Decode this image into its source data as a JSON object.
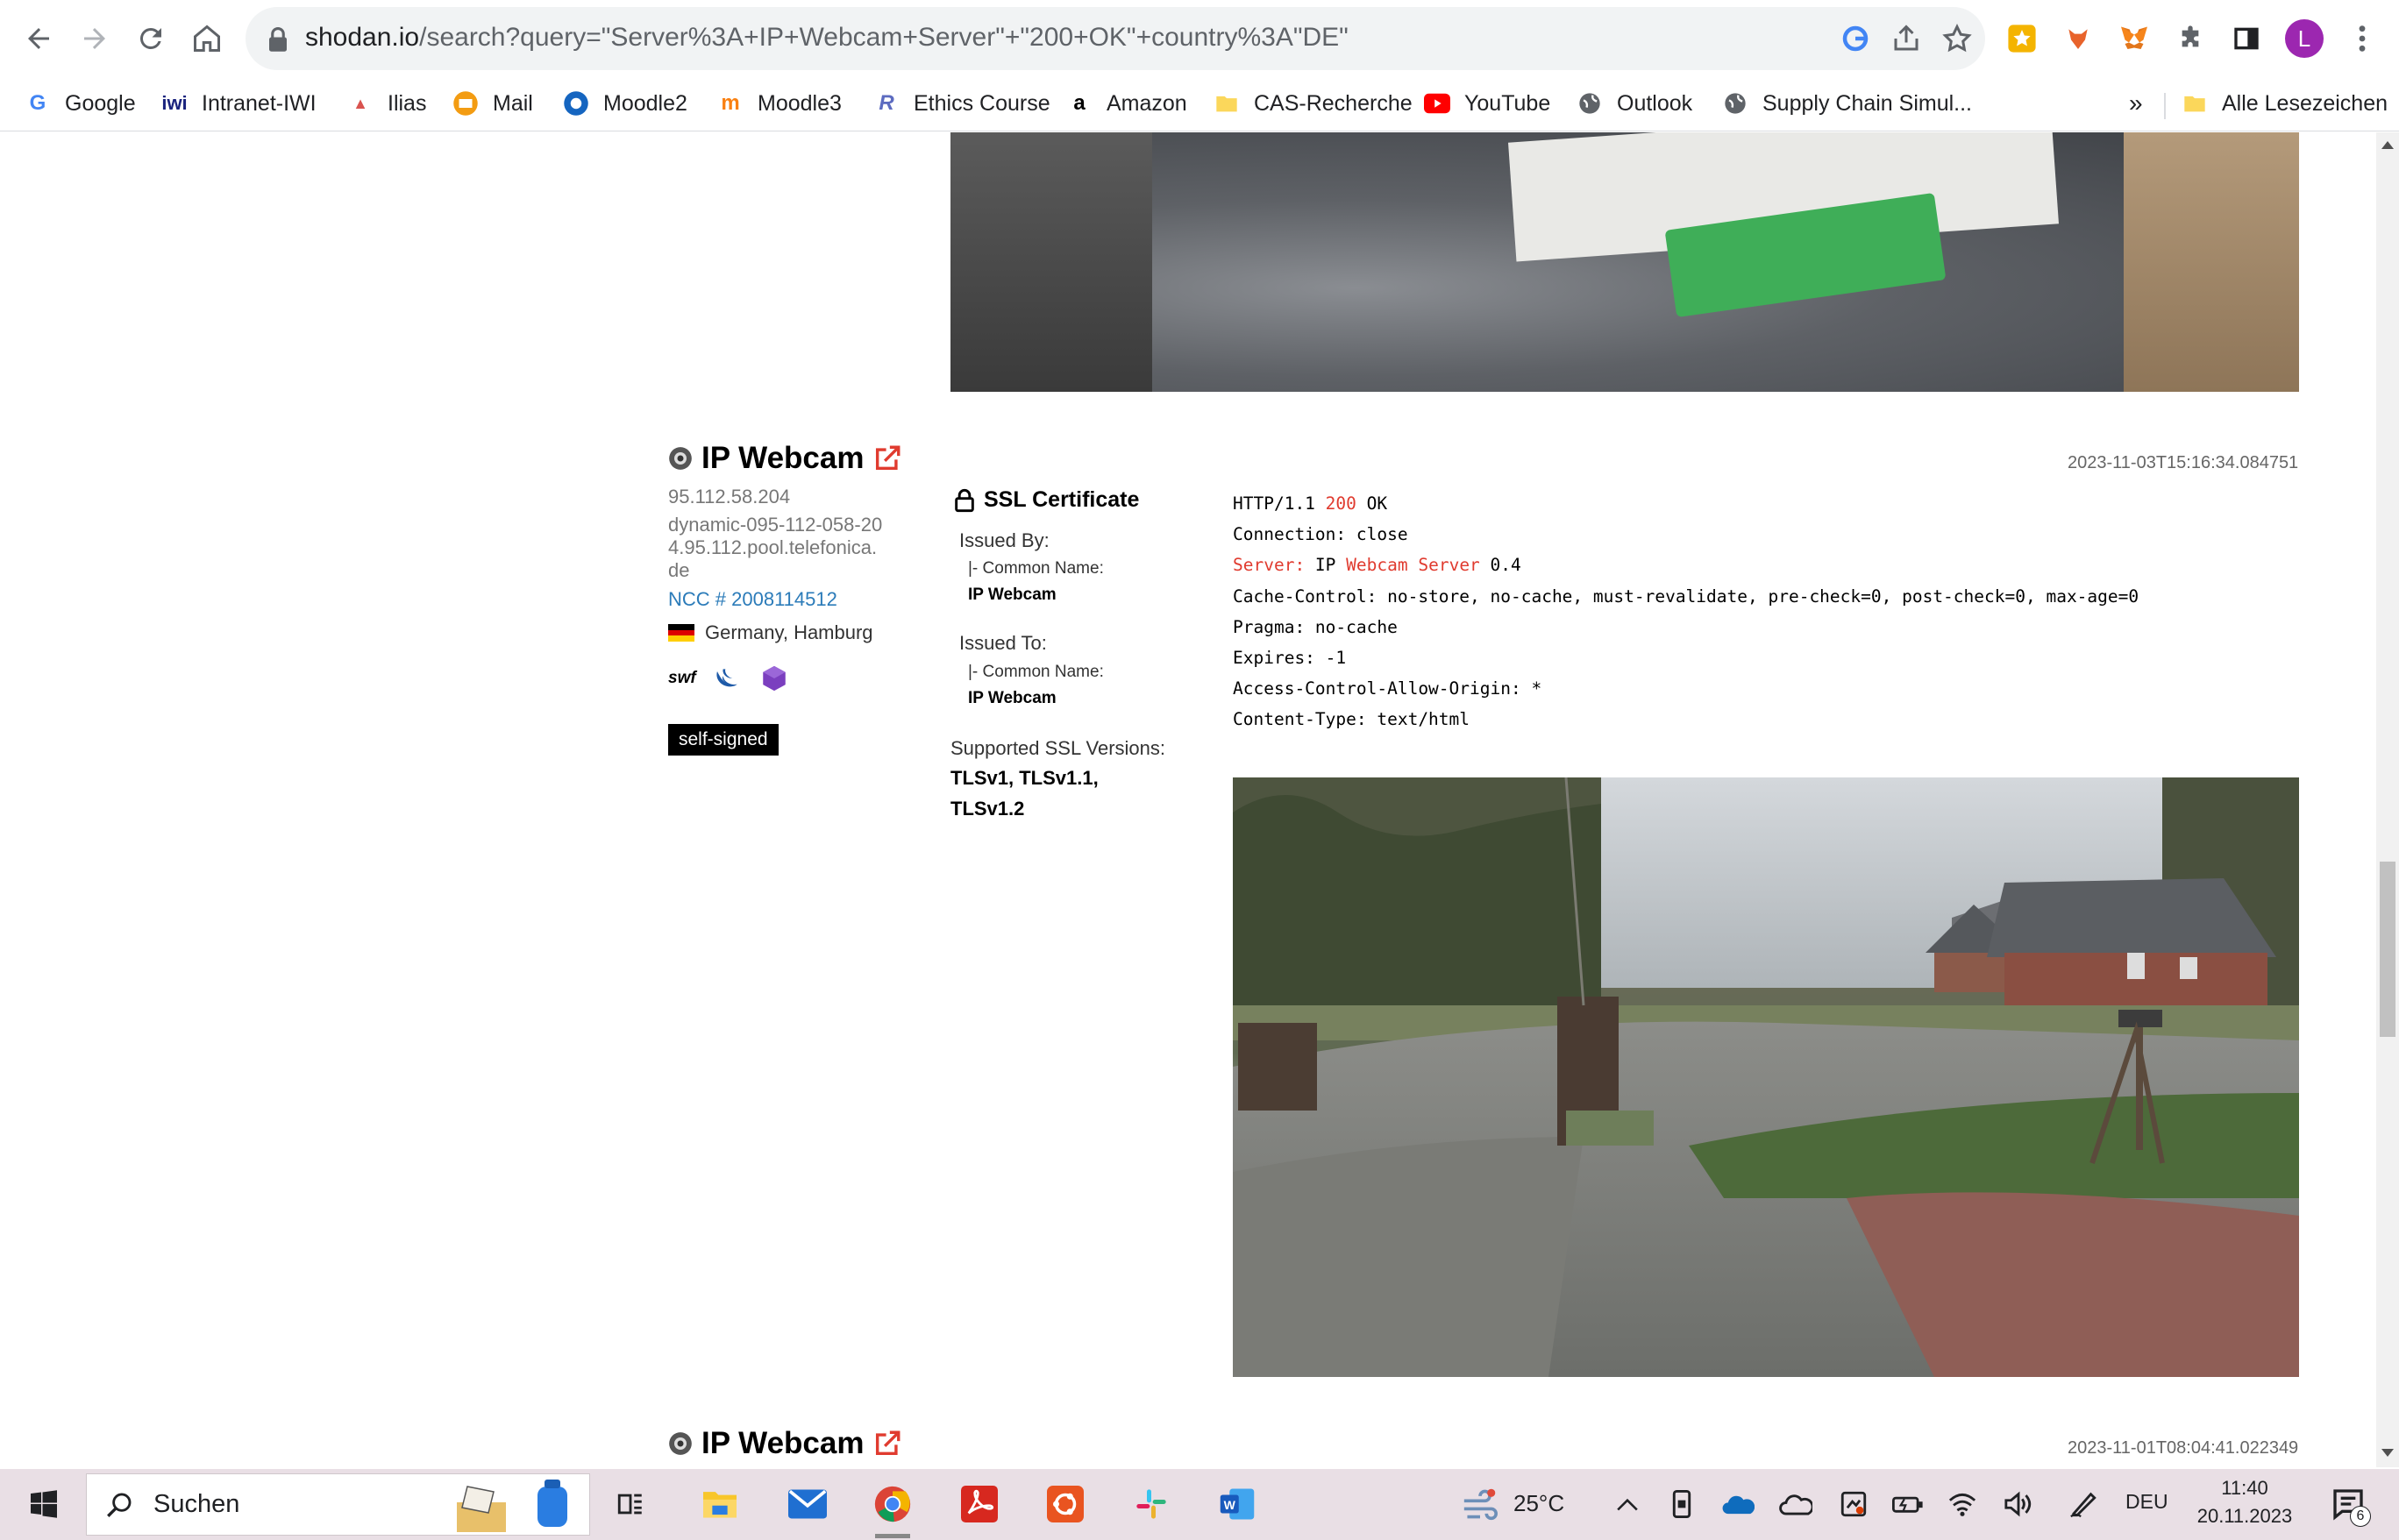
{
  "browser": {
    "url_host": "shodan.io",
    "url_rest": "/search?query=\"Server%3A+IP+Webcam+Server\"+\"200+OK\"+country%3A\"DE\"",
    "profile_initial": "L",
    "bookmarks": [
      {
        "label": "Google",
        "icon": "google-icon"
      },
      {
        "label": "Intranet-IWI",
        "icon": "iwi-icon"
      },
      {
        "label": "Ilias",
        "icon": "ilias-icon"
      },
      {
        "label": "Mail",
        "icon": "mail-icon"
      },
      {
        "label": "Moodle2",
        "icon": "moodle2-icon"
      },
      {
        "label": "Moodle3",
        "icon": "moodle3-icon"
      },
      {
        "label": "Ethics Course",
        "icon": "ethics-icon"
      },
      {
        "label": "Amazon",
        "icon": "amazon-icon"
      },
      {
        "label": "CAS-Recherche",
        "icon": "folder-icon"
      },
      {
        "label": "YouTube",
        "icon": "youtube-icon"
      },
      {
        "label": "Outlook",
        "icon": "globe-icon"
      },
      {
        "label": "Supply Chain Simul...",
        "icon": "globe-icon"
      }
    ],
    "overflow": "»",
    "all_bookmarks": "Alle Lesezeichen"
  },
  "result": {
    "title": "IP Webcam",
    "timestamp": "2023-11-03T15:16:34.084751",
    "ip": "95.112.58.204",
    "hostname_lines": [
      "dynamic-095-112-058-20",
      "4.95.112.pool.telefonica.",
      "de"
    ],
    "org": "NCC # 2008114512",
    "location": "Germany, Hamburg",
    "tech": [
      "swf",
      "jquery",
      "bootstrap"
    ],
    "tag": "self-signed",
    "ssl": {
      "heading": "SSL Certificate",
      "issued_by": "Issued By:",
      "issued_to": "Issued To:",
      "cn_label": "|- Common Name:",
      "issued_by_cn": "IP Webcam",
      "issued_to_cn": "IP Webcam",
      "versions_label": "Supported SSL Versions:",
      "versions_line1": "TLSv1, TLSv1.1,",
      "versions_line2": "TLSv1.2"
    },
    "banner": {
      "l1a": "HTTP/1.1 ",
      "l1b": "200",
      "l1c": " OK",
      "l2": "Connection: close",
      "l3a": "Server:",
      "l3b": " IP ",
      "l3c": "Webcam",
      "l3d": " ",
      "l3e": "Server",
      "l3f": " 0.4",
      "l4": "Cache-Control: no-store, no-cache, must-revalidate, pre-check=0, post-check=0, max-age=0",
      "l5": "Pragma: no-cache",
      "l6": "Expires: -1",
      "l7": "Access-Control-Allow-Origin: *",
      "l8": "Content-Type: text/html"
    }
  },
  "next_result": {
    "title": "IP Webcam",
    "timestamp": "2023-11-01T08:04:41.022349"
  },
  "taskbar": {
    "search": "Suchen",
    "temperature": "25°C",
    "language": "DEU",
    "time": "11:40",
    "date": "20.11.2023",
    "notifications": "6"
  }
}
